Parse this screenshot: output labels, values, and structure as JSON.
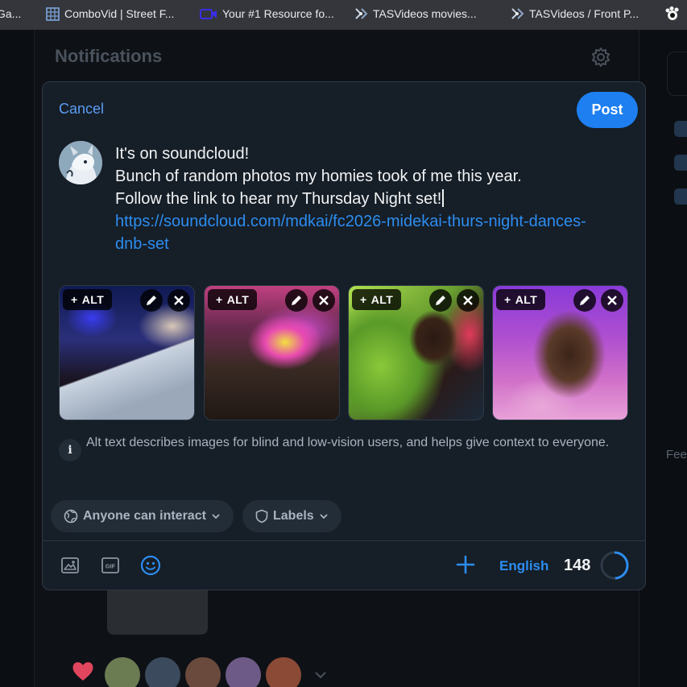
{
  "bookmarks": [
    {
      "label": "Ga...",
      "icon": "partial-icon"
    },
    {
      "label": "ComboVid | Street F...",
      "icon": "grid-icon"
    },
    {
      "label": "Your #1 Resource fo...",
      "icon": "camera-icon"
    },
    {
      "label": "TASVideos movies...",
      "icon": "tasvideos-icon"
    },
    {
      "label": "TASVideos / Front P...",
      "icon": "tasvideos-icon"
    },
    {
      "label": "",
      "icon": "paw-icon"
    }
  ],
  "background": {
    "title": "Notifications",
    "feeds_label": "Fee"
  },
  "composer": {
    "cancel_label": "Cancel",
    "post_label": "Post",
    "text_lines": [
      "It's on soundcloud!",
      "Bunch of random photos my homies took of me this year.",
      "Follow the link to hear my Thursday Night set!"
    ],
    "link": "https://soundcloud.com/mdkai/fc2026-midekai-thurs-night-dances-dnb-set",
    "images": [
      {
        "alt_label": "ALT"
      },
      {
        "alt_label": "ALT"
      },
      {
        "alt_label": "ALT"
      },
      {
        "alt_label": "ALT"
      }
    ],
    "info_text": "Alt text describes images for blind and low-vision users, and helps give context to everyone.",
    "interaction_label": "Anyone can interact",
    "labels_label": "Labels",
    "language": "English",
    "char_count": "148",
    "char_progress": 0.49
  },
  "colors": {
    "accent": "#1d7ff0",
    "link": "#2c8df0",
    "modal_bg": "#161e27"
  }
}
